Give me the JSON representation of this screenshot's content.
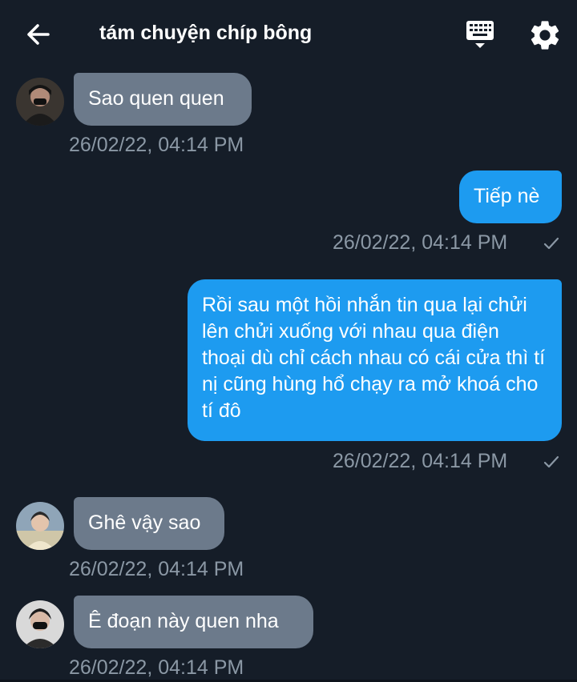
{
  "header": {
    "title": "tám chuyện chíp bông",
    "back_icon": "arrow-left-icon",
    "keyboard_icon": "keyboard-icon",
    "settings_icon": "gear-icon"
  },
  "colors": {
    "background": "#151d28",
    "incoming_bubble": "#6c7a8b",
    "outgoing_bubble": "#1d9bf0",
    "timestamp": "#8b98a5"
  },
  "messages": [
    {
      "direction": "incoming",
      "text": "Sao quen quen",
      "timestamp": "26/02/22, 04:14 PM"
    },
    {
      "direction": "outgoing",
      "text": "Tiếp nè",
      "timestamp": "26/02/22, 04:14 PM"
    },
    {
      "direction": "outgoing",
      "text": "Rồi sau một hồi nhắn tin qua lại chửi lên chửi xuống với nhau qua điện thoại dù chỉ cách nhau có cái cửa thì tí nị cũng hùng hổ chạy ra mở khoá cho tí đô",
      "timestamp": "26/02/22, 04:14 PM"
    },
    {
      "direction": "incoming",
      "text": "Ghê vậy sao",
      "timestamp": "26/02/22, 04:14 PM"
    },
    {
      "direction": "incoming",
      "text": "Ê đoạn này quen nha",
      "timestamp": "26/02/22, 04:14 PM"
    }
  ]
}
